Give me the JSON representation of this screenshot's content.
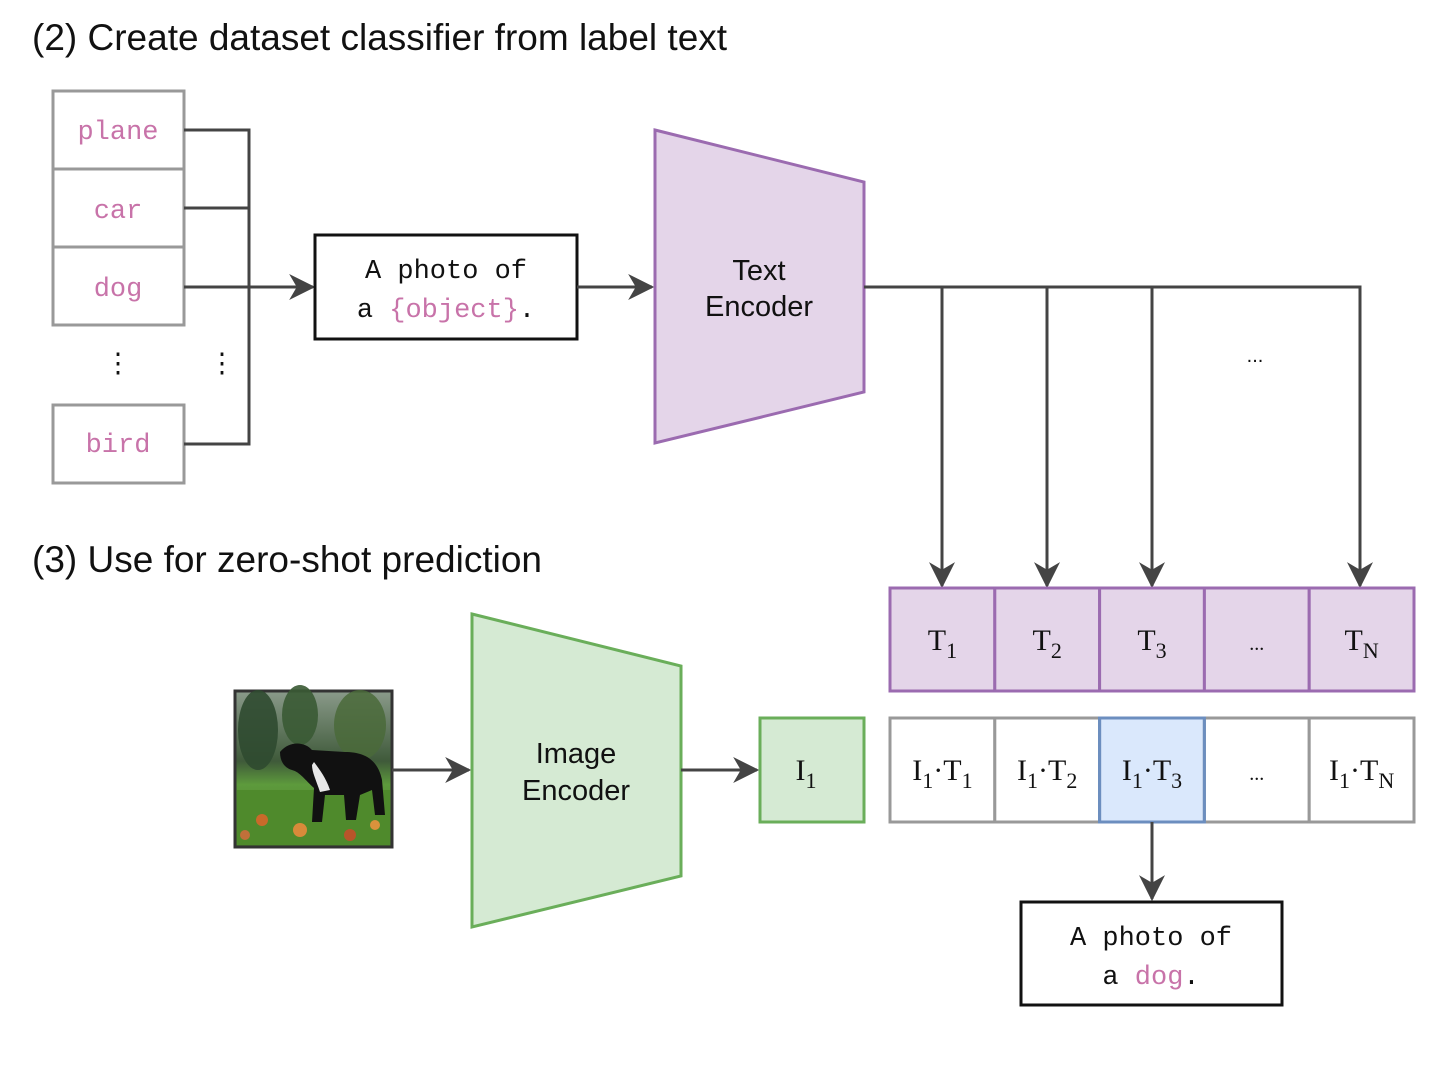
{
  "section2": {
    "title": "(2) Create dataset classifier from label text",
    "labels": [
      "plane",
      "car",
      "dog",
      "bird"
    ],
    "ellipsis_vertical": "⋮",
    "template": {
      "line1": "A photo of",
      "line2_prefix": "a ",
      "line2_placeholder": "{object}",
      "line2_suffix": "."
    },
    "text_encoder": {
      "line1": "Text",
      "line2": "Encoder"
    },
    "ellipsis": "..."
  },
  "section3": {
    "title": "(3) Use for zero-shot prediction",
    "image_alt": "dog photo",
    "image_encoder": {
      "line1": "Image",
      "line2": "Encoder"
    },
    "image_embedding": {
      "main": "I",
      "sub": "1"
    },
    "text_embeddings": [
      {
        "main": "T",
        "sub": "1"
      },
      {
        "main": "T",
        "sub": "2"
      },
      {
        "main": "T",
        "sub": "3"
      },
      {
        "main": "...",
        "sub": ""
      },
      {
        "main": "T",
        "sub": "N"
      }
    ],
    "similarities": [
      {
        "a": "I",
        "asub": "1",
        "b": "T",
        "bsub": "1"
      },
      {
        "a": "I",
        "asub": "1",
        "b": "T",
        "bsub": "2"
      },
      {
        "a": "I",
        "asub": "1",
        "b": "T",
        "bsub": "3"
      },
      {
        "a": "...",
        "asub": "",
        "b": "",
        "bsub": ""
      },
      {
        "a": "I",
        "asub": "1",
        "b": "T",
        "bsub": "N"
      }
    ],
    "highlighted_index": 2,
    "result": {
      "line1": "A photo of",
      "line2_prefix": "a ",
      "line2_label": "dog",
      "line2_suffix": "."
    }
  },
  "colors": {
    "text_purple_fill": "#e4d5e9",
    "text_purple_stroke": "#9b6bb0",
    "image_green_fill": "#d5ead3",
    "image_green_stroke": "#6aae5a",
    "highlight_blue_fill": "#dae8fc",
    "highlight_blue_stroke": "#6c8ebf",
    "label_pink": "#c873a9"
  }
}
